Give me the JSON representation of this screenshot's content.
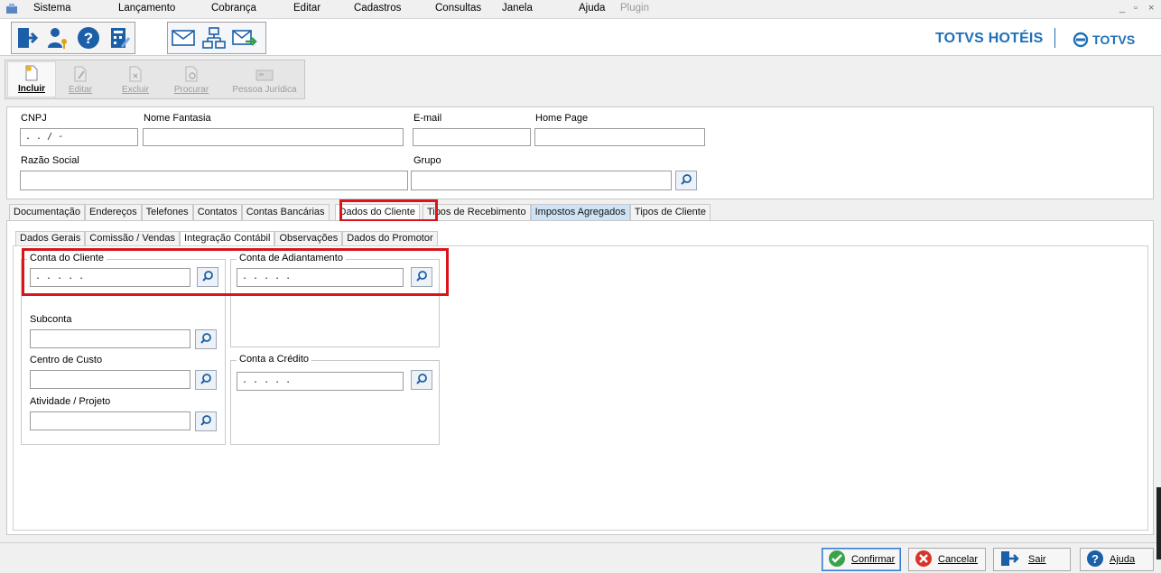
{
  "menu": {
    "items": [
      "Sistema",
      "Lançamento",
      "Cobrança",
      "Editar",
      "Cadastros",
      "Consultas",
      "Janela",
      "Ajuda"
    ],
    "plugin_label": "Plugin",
    "window_controls": [
      "_",
      "▫",
      "×"
    ]
  },
  "brand": {
    "name": "TOTVS HOTÉIS",
    "logo_text": "TOTVS",
    "color": "#1e6fb8"
  },
  "crud_toolbar": {
    "include": "Incluir",
    "edit": "Editar",
    "delete": "Excluir",
    "search": "Procurar",
    "legal_person": "Pessoa Jurídica"
  },
  "form": {
    "cnpj_label": "CNPJ",
    "cnpj_value": " . .  /  -",
    "trade_name_label": "Nome Fantasia",
    "trade_name_value": "",
    "email_label": "E-mail",
    "email_value": "",
    "home_page_label": "Home Page",
    "home_page_value": "",
    "company_name_label": "Razão Social",
    "company_name_value": "",
    "group_label": "Grupo",
    "group_value": ""
  },
  "tabs_main": [
    {
      "label": "Documentação",
      "style": "normal"
    },
    {
      "label": "Endereços",
      "style": "normal"
    },
    {
      "label": "Telefones",
      "style": "normal"
    },
    {
      "label": "Contatos",
      "style": "normal"
    },
    {
      "label": "Contas Bancárias",
      "style": "normal"
    },
    {
      "label": "Dados do Cliente",
      "style": "active"
    },
    {
      "label": "Tipos de Recebimento",
      "style": "normal"
    },
    {
      "label": "Impostos Agregados",
      "style": "blue"
    },
    {
      "label": "Tipos de Cliente",
      "style": "normal"
    }
  ],
  "tabs_sub": [
    {
      "label": "Dados Gerais",
      "style": "normal"
    },
    {
      "label": "Comissão / Vendas",
      "style": "normal"
    },
    {
      "label": "Integração Contábil",
      "style": "active"
    },
    {
      "label": "Observações",
      "style": "normal"
    },
    {
      "label": "Dados do Promotor",
      "style": "normal"
    }
  ],
  "accounting": {
    "client_account_title": "Conta do Cliente",
    "client_account_value": ". . . . .",
    "advance_account_title": "Conta de Adiantamento",
    "advance_account_value": ". . . . .",
    "subaccount_label": "Subconta",
    "subaccount_value": "",
    "cost_center_label": "Centro de Custo",
    "cost_center_value": "",
    "activity_label": "Atividade / Projeto",
    "activity_value": "",
    "credit_account_title": "Conta a Crédito",
    "credit_account_value": ". . . . ."
  },
  "footer": {
    "confirm": "Confirmar",
    "cancel": "Cancelar",
    "exit": "Sair",
    "help": "Ajuda"
  },
  "colors": {
    "highlight": "#d9151b",
    "accent_blue": "#1e6fb8",
    "confirm_green": "#3aa34a",
    "cancel_red": "#d9342b"
  }
}
